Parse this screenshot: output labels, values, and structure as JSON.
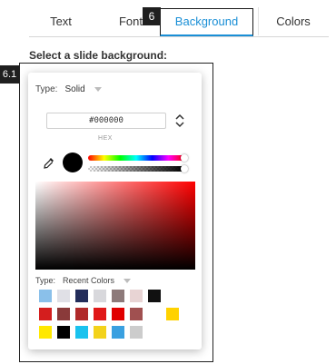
{
  "tabs": [
    {
      "label": "Text"
    },
    {
      "label": "Font"
    },
    {
      "label": "Background"
    },
    {
      "label": "Colors"
    }
  ],
  "badges": {
    "tab": "6",
    "panel": "6.1"
  },
  "section": {
    "heading": "Select a slide background:"
  },
  "picker": {
    "type_label": "Type:",
    "type_value": "Solid",
    "hex_value": "#000000",
    "hex_caption": "HEX",
    "current_color": "#000000",
    "recent_type_label": "Type:",
    "recent_type_value": "Recent Colors",
    "recent_colors": [
      [
        "#8ac0ea",
        "#e0e0e6",
        "#232d5a",
        "#d8d8dc",
        "#8d7a7a",
        "#e8d4d4",
        "#111111"
      ],
      [
        "#d41e1e",
        "#8a3a3a",
        "#b02a2a",
        "#e01818",
        "#e00000",
        "#a05050",
        null,
        "#ffd200"
      ],
      [
        "#ffe800",
        "#000000",
        "#1ac2ee",
        "#f3d21a",
        "#3aa0e0",
        "#cccccc"
      ]
    ]
  }
}
